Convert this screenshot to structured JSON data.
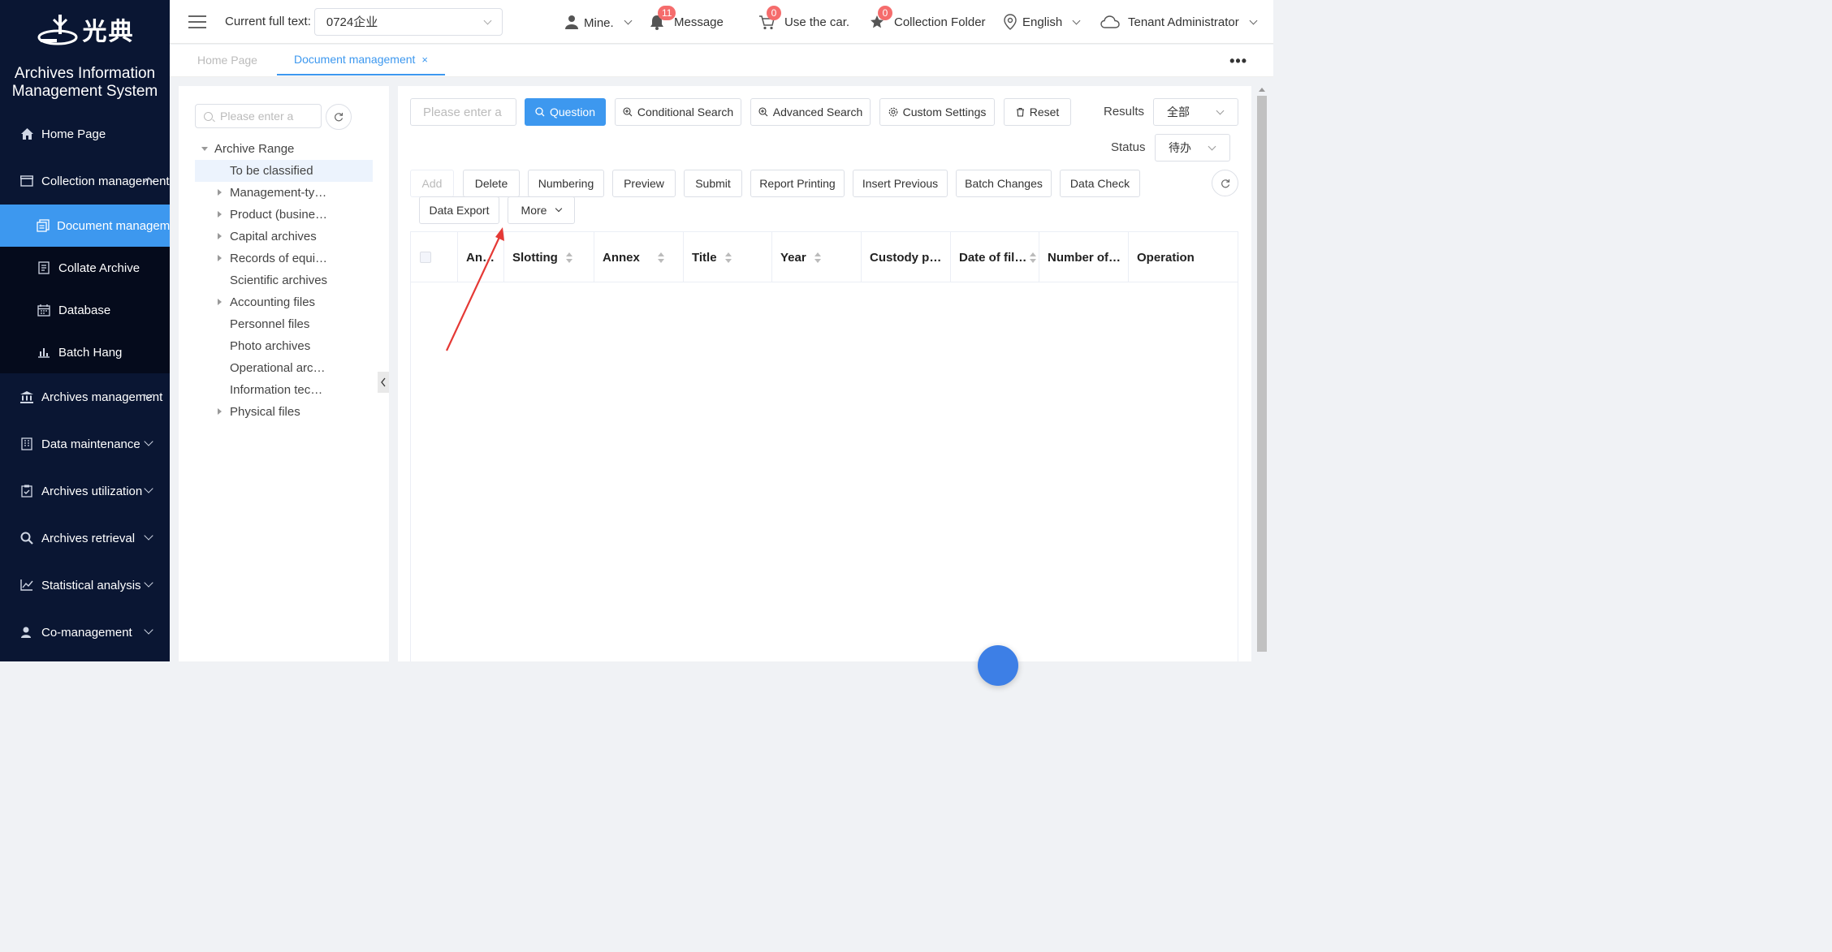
{
  "app": {
    "logo_text": "光典",
    "system_title": "Archives Information Management System"
  },
  "sidebar": {
    "items": [
      {
        "label": "Home Page",
        "icon": "home-icon",
        "has_children": false
      },
      {
        "label": "Collection management",
        "icon": "box-icon",
        "has_children": true,
        "expanded": true,
        "children": [
          {
            "label": "Document management",
            "icon": "documents-icon",
            "active": true
          },
          {
            "label": "Collate Archive",
            "icon": "file-icon",
            "active": false
          },
          {
            "label": "Database",
            "icon": "calendar-icon",
            "active": false
          },
          {
            "label": "Batch Hang",
            "icon": "bar-chart-icon",
            "active": false
          }
        ]
      },
      {
        "label": "Archives management",
        "icon": "bank-icon",
        "has_children": true
      },
      {
        "label": "Data maintenance",
        "icon": "building-icon",
        "has_children": true
      },
      {
        "label": "Archives utilization",
        "icon": "clipboard-check-icon",
        "has_children": true
      },
      {
        "label": "Archives retrieval",
        "icon": "search-icon",
        "has_children": true
      },
      {
        "label": "Statistical analysis",
        "icon": "line-chart-icon",
        "has_children": true
      },
      {
        "label": "Co-management",
        "icon": "user-icon",
        "has_children": true
      }
    ]
  },
  "header": {
    "full_text_label": "Current full text:",
    "full_text_value": "0724企业",
    "mine_label": "Mine.",
    "message_label": "Message",
    "message_count": "11",
    "car_label": "Use the car.",
    "car_count": "0",
    "collection_label": "Collection Folder",
    "collection_count": "0",
    "language_label": "English",
    "tenant_label": "Tenant Administrator"
  },
  "tabs": [
    {
      "label": "Home Page",
      "active": false
    },
    {
      "label": "Document management",
      "active": true,
      "close": "×"
    }
  ],
  "tabs_more": "•••",
  "tree": {
    "search_placeholder": "Please enter a",
    "root_label": "Archive Range",
    "nodes": [
      {
        "label": "To be classified",
        "expandable": false,
        "selected": true
      },
      {
        "label": "Management-ty…",
        "expandable": true
      },
      {
        "label": "Product (busine…",
        "expandable": true
      },
      {
        "label": "Capital archives",
        "expandable": true
      },
      {
        "label": "Records of equi…",
        "expandable": true
      },
      {
        "label": "Scientific archives",
        "expandable": false
      },
      {
        "label": "Accounting files",
        "expandable": true
      },
      {
        "label": "Personnel files",
        "expandable": false
      },
      {
        "label": "Photo archives",
        "expandable": false
      },
      {
        "label": "Operational arc…",
        "expandable": false
      },
      {
        "label": "Information tec…",
        "expandable": false
      },
      {
        "label": "Physical files",
        "expandable": true
      }
    ]
  },
  "toolbar": {
    "search_placeholder": "Please enter a",
    "question": "Question",
    "conditional": "Conditional Search",
    "advanced": "Advanced Search",
    "custom": "Custom Settings",
    "reset": "Reset",
    "results_label": "Results",
    "results_value": "全部",
    "status_label": "Status",
    "status_value": "待办"
  },
  "actions": {
    "add": "Add",
    "delete": "Delete",
    "numbering": "Numbering",
    "preview": "Preview",
    "submit": "Submit",
    "report": "Report Printing",
    "insert": "Insert Previous",
    "batch": "Batch Changes",
    "check": "Data Check",
    "export": "Data Export",
    "more": "More"
  },
  "table": {
    "columns": [
      "An…",
      "Slotting",
      "Annex",
      "Title",
      "Year",
      "Custody p…",
      "Date of fil…",
      "Number of…",
      "Operation"
    ],
    "rows": []
  },
  "colors": {
    "sidebar_bg": "#0a1633",
    "accent": "#3d98ef",
    "badge": "#f56c6c",
    "annotation_arrow": "#e53935"
  }
}
